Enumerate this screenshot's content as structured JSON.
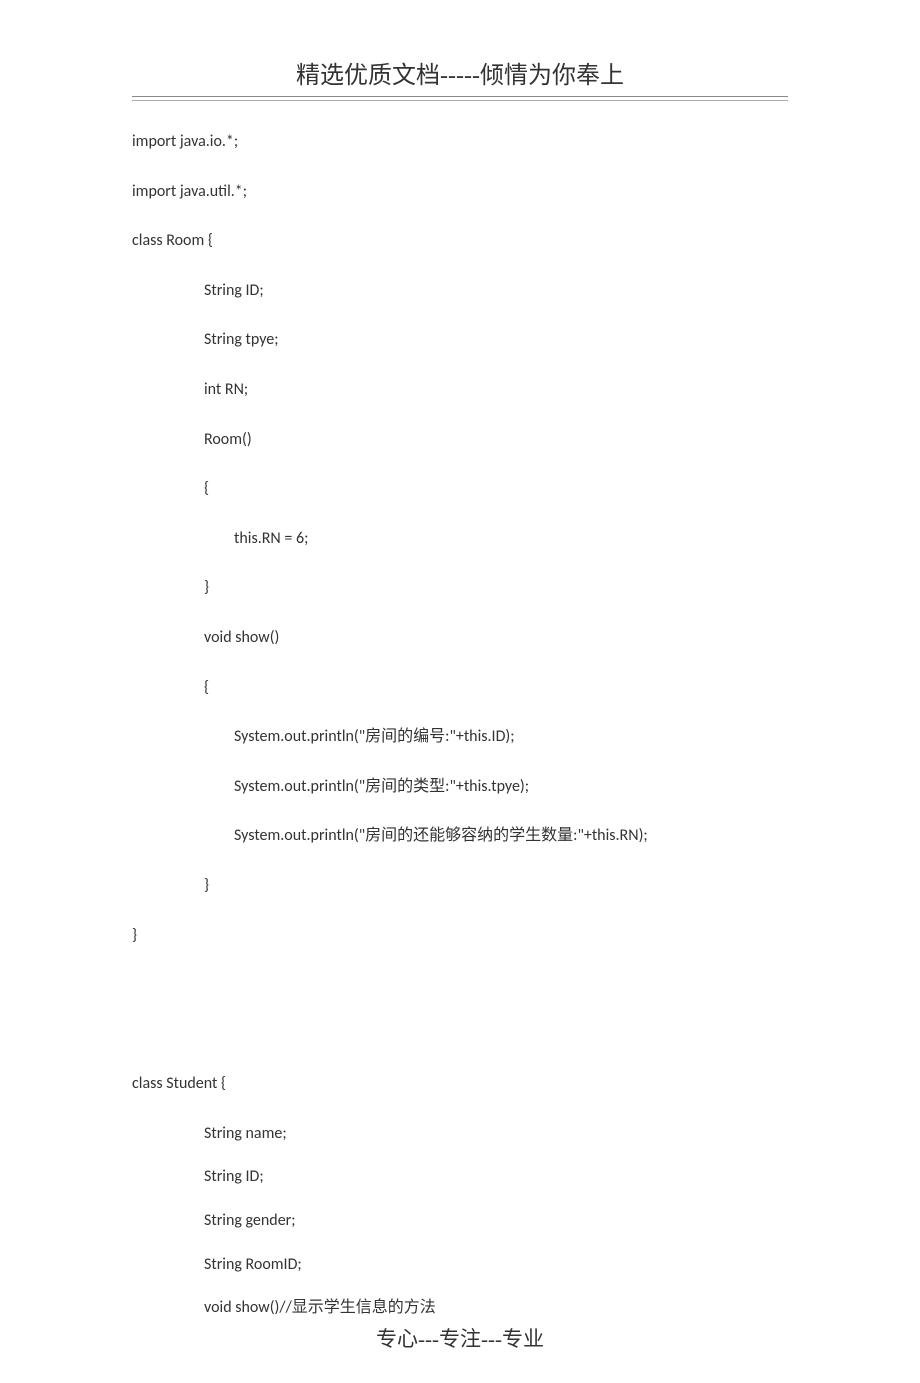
{
  "header": {
    "title": "精选优质文档-----倾情为你奉上"
  },
  "code": {
    "lines": [
      {
        "text": "import java.io.*;",
        "indent": 0
      },
      {
        "text": "import java.util.*;",
        "indent": 0
      },
      {
        "text": "class Room {",
        "indent": 0
      },
      {
        "text": "String ID;",
        "indent": 1
      },
      {
        "text": "String tpye;",
        "indent": 1
      },
      {
        "text": "int RN;",
        "indent": 1
      },
      {
        "text": "Room()",
        "indent": 1
      },
      {
        "text": "{",
        "indent": 1
      },
      {
        "text": "this.RN = 6;",
        "indent": 2
      },
      {
        "text": "}",
        "indent": 1
      },
      {
        "text": "void show()",
        "indent": 1
      },
      {
        "text": "{",
        "indent": 1
      },
      {
        "text": "System.out.println(\"房间的编号:\"+this.ID);",
        "indent": 2
      },
      {
        "text": "System.out.println(\"房间的类型:\"+this.tpye);",
        "indent": 2
      },
      {
        "text": "System.out.println(\"房间的还能够容纳的学生数量:\"+this.RN);",
        "indent": 2
      },
      {
        "text": "}",
        "indent": 1
      },
      {
        "text": "}",
        "indent": 0
      },
      {
        "text": " ",
        "indent": 0
      },
      {
        "text": " ",
        "indent": 0
      },
      {
        "text": "class Student {",
        "indent": 0
      },
      {
        "text": "String name;",
        "indent": 1,
        "tight": true
      },
      {
        "text": "String ID;",
        "indent": 1,
        "tight": true
      },
      {
        "text": "String gender;",
        "indent": 1,
        "tight": true
      },
      {
        "text": "String RoomID;",
        "indent": 1,
        "tight": true
      },
      {
        "text": "void show()//显示学生信息的方法",
        "indent": 1,
        "tight": true,
        "last": true
      }
    ]
  },
  "footer": {
    "text": "专心---专注---专业"
  }
}
